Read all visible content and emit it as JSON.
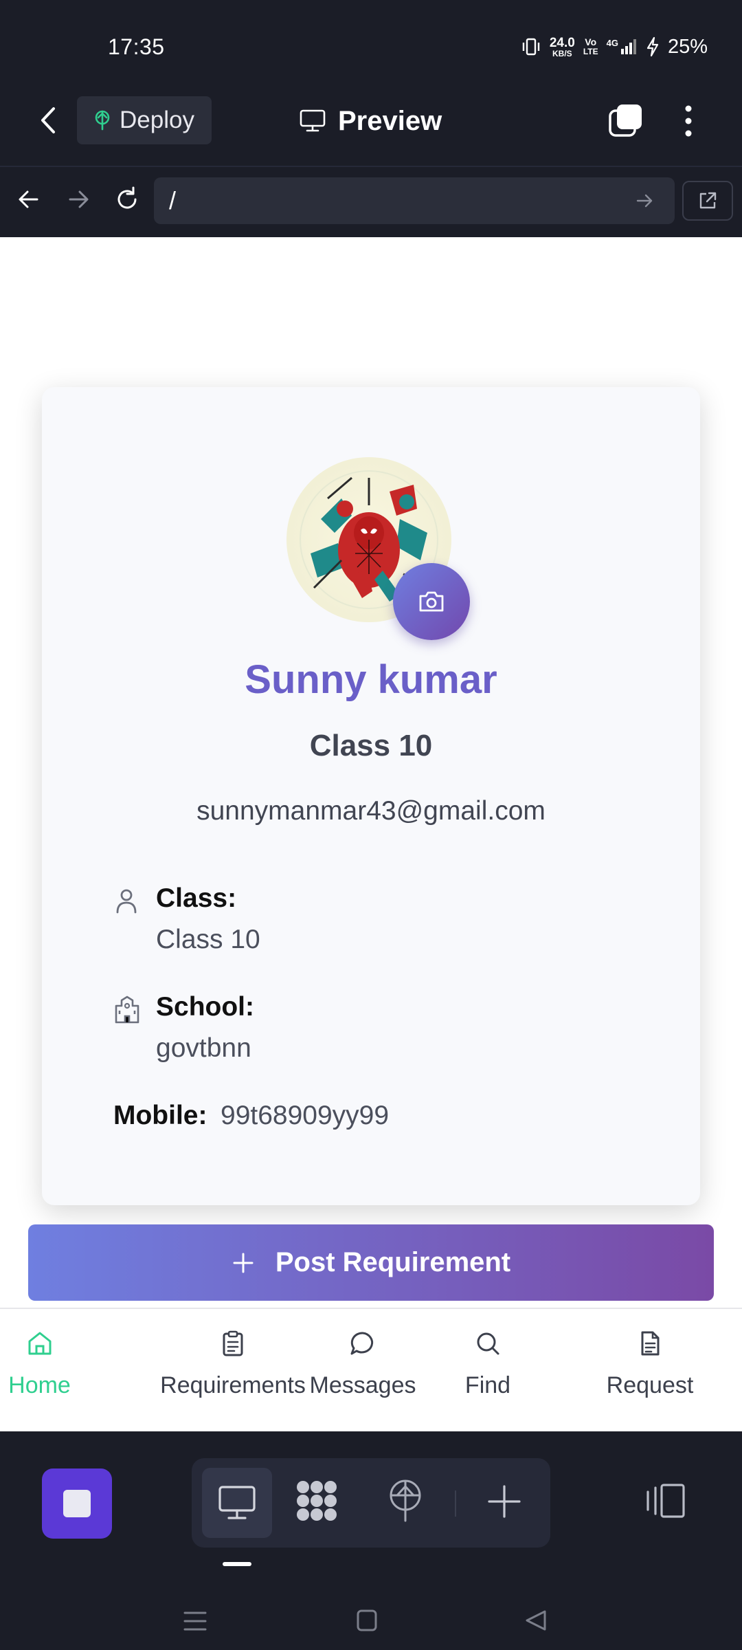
{
  "status_bar": {
    "time": "17:35",
    "net_speed_value": "24.0",
    "net_speed_unit": "KB/S",
    "volte_top": "Vo",
    "volte_bottom": "LTE",
    "network": "4G",
    "battery": "25%"
  },
  "header": {
    "deploy_label": "Deploy",
    "title": "Preview"
  },
  "browser": {
    "url": "/"
  },
  "profile": {
    "name": "Sunny kumar",
    "class_heading": "Class 10",
    "email": "sunnymanmar43@gmail.com",
    "class_label": "Class:",
    "class_value": "Class 10",
    "school_label": "School:",
    "school_value": "govtbnn",
    "mobile_label": "Mobile:",
    "mobile_value": "99t68909yy99"
  },
  "post_button": {
    "label": "Post Requirement"
  },
  "bottom_nav": {
    "items": [
      {
        "label": "Home",
        "icon": "home-icon",
        "active": true
      },
      {
        "label": "Requirements",
        "icon": "clipboard-icon",
        "active": false
      },
      {
        "label": "Messages",
        "icon": "chat-bubble-icon",
        "active": false
      },
      {
        "label": "Find",
        "icon": "search-icon",
        "active": false
      },
      {
        "label": "Request",
        "icon": "document-icon",
        "active": false
      }
    ]
  },
  "colors": {
    "accent_active": "#2fcf8f",
    "name_color": "#6a5fc8",
    "gradient_start": "#6f7fe0",
    "gradient_end": "#7a4aa6",
    "stop_button": "#5b39d6"
  }
}
